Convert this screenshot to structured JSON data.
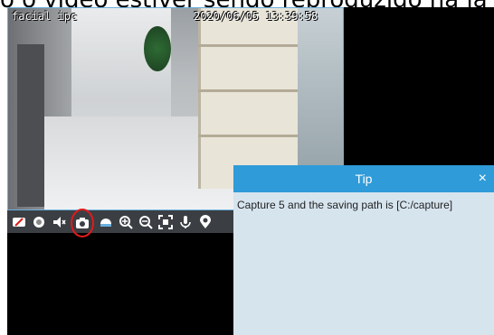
{
  "caption": "o o vídeo estiver sendo reproduzido na ja",
  "video": {
    "camera_name": "facial ipc",
    "timestamp": "2020/06/05 13:39:58"
  },
  "toolbar": {
    "buttons": [
      {
        "name": "close-preview-icon"
      },
      {
        "name": "record-icon"
      },
      {
        "name": "audio-icon"
      },
      {
        "name": "snapshot-icon"
      },
      {
        "name": "stream-icon"
      },
      {
        "name": "zoom-in-icon"
      },
      {
        "name": "zoom-out-icon"
      },
      {
        "name": "fit-screen-icon"
      },
      {
        "name": "microphone-icon"
      },
      {
        "name": "location-icon"
      }
    ]
  },
  "tip": {
    "title": "Tip",
    "close_glyph": "×",
    "message": "Capture 5 and the saving path is [C:/capture]"
  },
  "colors": {
    "tip_header": "#2f9bd8",
    "tip_body": "#d6e4ee",
    "highlight": "#e01b1b",
    "toolbar": "#3b3f44"
  }
}
